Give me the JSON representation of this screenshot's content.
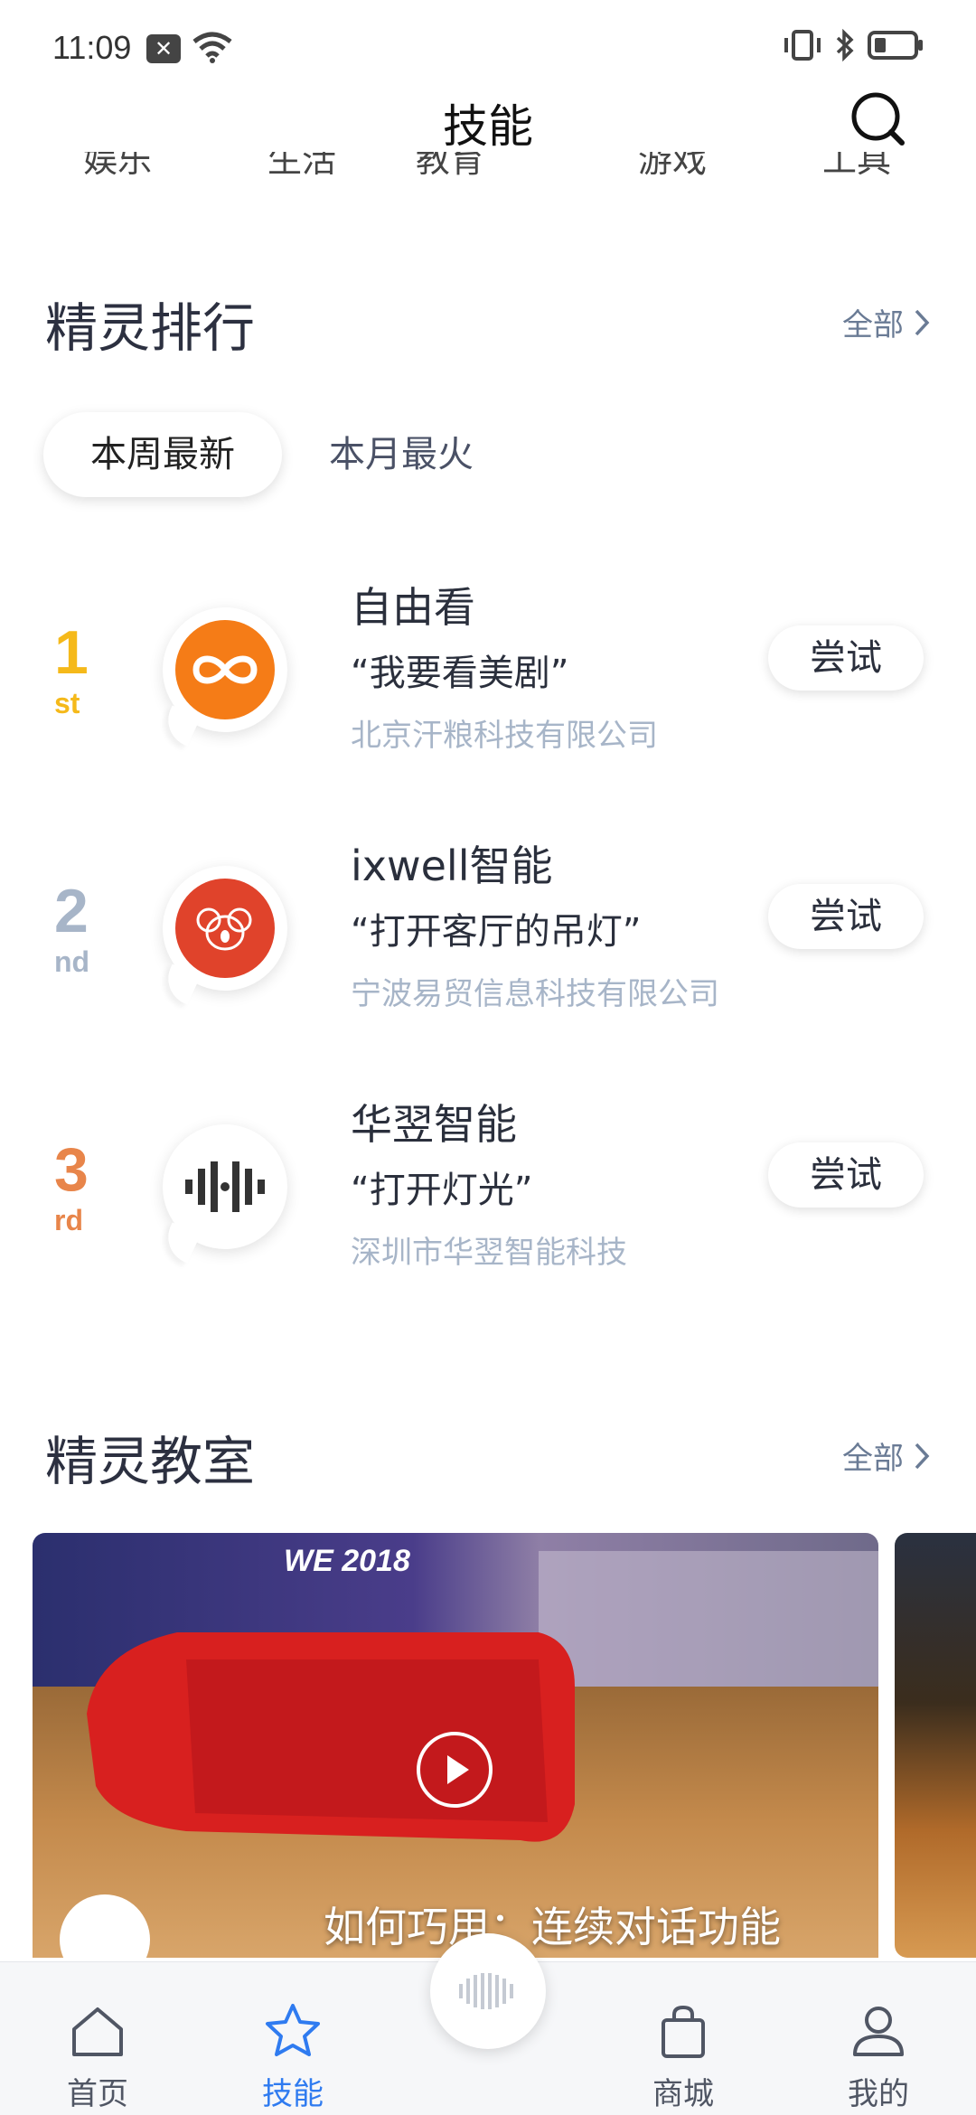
{
  "status_bar": {
    "time": "11:09"
  },
  "header": {
    "title": "技能"
  },
  "category_row": [
    "娱乐",
    "生活",
    "教育",
    "游戏",
    "工具"
  ],
  "ranking": {
    "title": "精灵排行",
    "see_all": "全部",
    "tabs": [
      {
        "label": "本周最新",
        "active": true
      },
      {
        "label": "本月最火",
        "active": false
      }
    ],
    "items": [
      {
        "rank": "1",
        "suffix": "st",
        "rank_color": "#f5b91a",
        "name": "自由看",
        "quote": "“我要看美剧”",
        "company": "北京汗粮科技有限公司",
        "button": "尝试",
        "logo": "infinity-logo",
        "logo_color": "#f57c17"
      },
      {
        "rank": "2",
        "suffix": "nd",
        "rank_color": "#a7b5c8",
        "name": "ixwell智能",
        "quote": "“打开客厅的吊灯”",
        "company": "宁波易贸信息科技有限公司",
        "button": "尝试",
        "logo": "koala-logo",
        "logo_color": "#e0432b"
      },
      {
        "rank": "3",
        "suffix": "rd",
        "rank_color": "#e8854a",
        "name": "华翌智能",
        "quote": "“打开灯光”",
        "company": "深圳市华翌智能科技",
        "button": "尝试",
        "logo": "soundwave-logo",
        "logo_color": "#333333"
      }
    ]
  },
  "classroom": {
    "title": "精灵教室",
    "see_all": "全部",
    "video_caption": "如何巧用：连续对话功能",
    "video_tag": "WE 2018"
  },
  "bottom_nav": {
    "items": [
      {
        "label": "首页",
        "icon": "home-icon",
        "active": false
      },
      {
        "label": "技能",
        "icon": "star-icon",
        "active": true
      },
      {
        "label": "商城",
        "icon": "bag-icon",
        "active": false
      },
      {
        "label": "我的",
        "icon": "profile-icon",
        "active": false
      }
    ]
  },
  "accent_color": "#2f7bf0"
}
